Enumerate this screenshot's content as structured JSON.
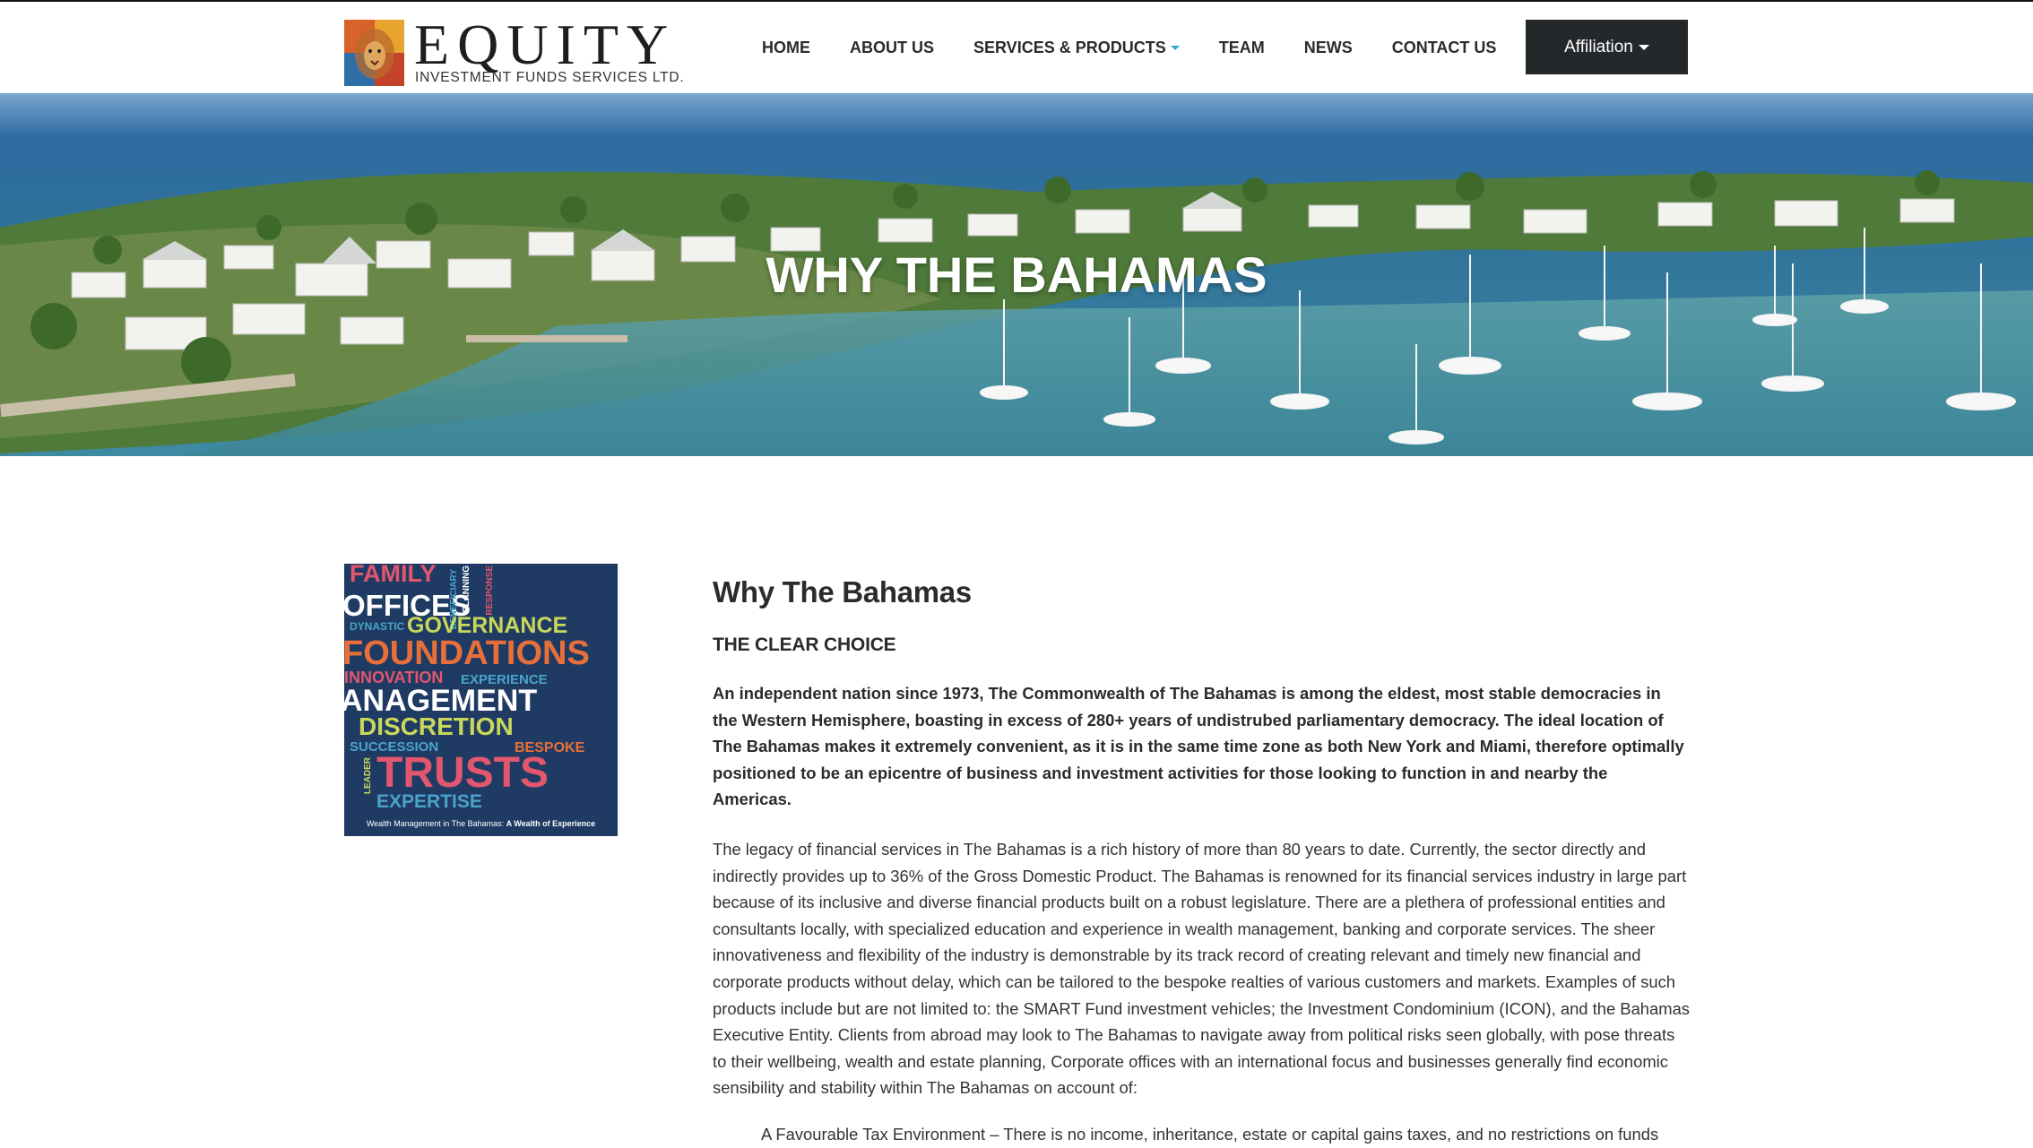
{
  "header": {
    "logo_word": "EQUITY",
    "logo_sub": "INVESTMENT FUNDS SERVICES LTD.",
    "nav": [
      "HOME",
      "ABOUT US",
      "SERVICES & PRODUCTS",
      "TEAM",
      "NEWS",
      "CONTACT US"
    ],
    "affiliation_label": "Affiliation"
  },
  "hero": {
    "title": "WHY THE BAHAMAS"
  },
  "aside": {
    "words": [
      "FAMILY",
      "OFFICES",
      "BENEFICIARY",
      "PLANNING",
      "RESPONSE",
      "DYNASTIC",
      "GOVERNANCE",
      "FOUNDATIONS",
      "INNOVATION",
      "EXPERIENCE",
      "ANAGEMENT",
      "DISCRETION",
      "SUCCESSION",
      "BESPOKE",
      "LEADER",
      "TRUSTS",
      "EXPERTISE"
    ],
    "caption_plain": "Wealth Management in The Bahamas: ",
    "caption_bold": "A Wealth of Experience"
  },
  "main": {
    "title": "Why The Bahamas",
    "subtitle": "THE CLEAR CHOICE",
    "lead": "An independent nation since 1973, The Commonwealth of The Bahamas is among the eldest, most stable democracies in the Western Hemisphere, boasting in excess of 280+ years of undistrubed parliamentary democracy. The ideal location of The Bahamas makes it extremely convenient, as it is in the same time zone as both New York and Miami, therefore optimally positioned to be an epicentre of business and investment activities for those looking to function in and nearby the Americas.",
    "body": "The legacy of financial services in The Bahamas is a rich history of more than 80 years to date. Currently, the sector directly and indirectly provides up to 36% of the Gross Domestic Product. The Bahamas is renowned for its financial services industry in large part because of its inclusive and diverse financial products built on a robust legislature. There are a plethera of professional entities and consultants locally, with specialized education and experience in wealth management, banking and corporate services. The sheer innovativeness and flexibility of the industry is demonstrable by its track record of creating relevant and timely new financial and corporate products without delay, which can be tailored to the bespoke realties of various customers and markets. Examples of such products include but are not limited to: the SMART Fund investment vehicles; the Investment Condominium (ICON), and the Bahamas Executive Entity. Clients from abroad may look to The Bahamas to navigate away from political risks seen globally, with pose threats to their wellbeing, wealth and estate planning, Corporate offices with an international focus and businesses generally find economic sensibility and stability within The Bahamas on account of:",
    "bullet_1": "A Favourable Tax Environment – There is no income, inheritance, estate or capital gains taxes, and no restrictions on funds"
  },
  "colors": {
    "accent": "#3aa3d8",
    "button_bg": "#25282b",
    "aside_bg": "#1f3b63"
  }
}
